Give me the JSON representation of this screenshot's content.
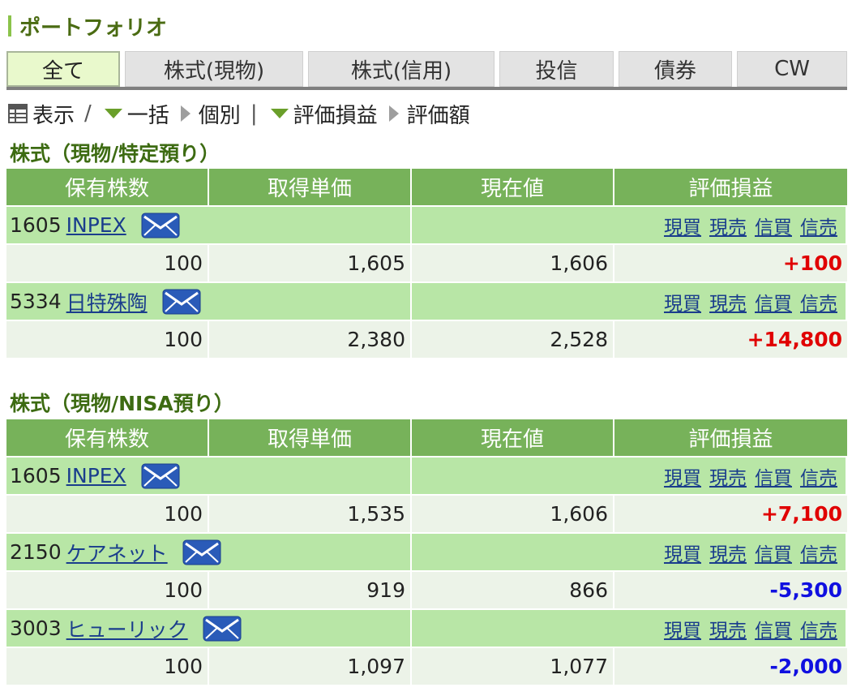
{
  "page": {
    "title": "ポートフォリオ"
  },
  "tabs": [
    {
      "label": "全て",
      "active": true
    },
    {
      "label": "株式(現物)"
    },
    {
      "label": "株式(信用)"
    },
    {
      "label": "投信"
    },
    {
      "label": "債券"
    },
    {
      "label": "CW"
    }
  ],
  "toolbar": {
    "display_label": "表示",
    "slash": "/",
    "bulk_label": "一括",
    "individual_label": "個別",
    "bar": "|",
    "eval_pl_label": "評価損益",
    "eval_amount_label": "評価額"
  },
  "headers": [
    "保有株数",
    "取得単価",
    "現在値",
    "評価損益"
  ],
  "actions": [
    "現買",
    "現売",
    "信買",
    "信売"
  ],
  "sections": [
    {
      "title": "株式（現物/特定預り）",
      "holdings": [
        {
          "code": "1605",
          "name": "INPEX",
          "shares": "100",
          "cost": "1,605",
          "price": "1,606",
          "pl": "+100",
          "sign": "pos"
        },
        {
          "code": "5334",
          "name": "日特殊陶",
          "shares": "100",
          "cost": "2,380",
          "price": "2,528",
          "pl": "+14,800",
          "sign": "pos"
        }
      ]
    },
    {
      "title": "株式（現物/NISA預り）",
      "holdings": [
        {
          "code": "1605",
          "name": "INPEX",
          "shares": "100",
          "cost": "1,535",
          "price": "1,606",
          "pl": "+7,100",
          "sign": "pos"
        },
        {
          "code": "2150",
          "name": "ケアネット",
          "shares": "100",
          "cost": "919",
          "price": "866",
          "pl": "-5,300",
          "sign": "neg"
        },
        {
          "code": "3003",
          "name": "ヒューリック",
          "shares": "100",
          "cost": "1,097",
          "price": "1,077",
          "pl": "-2,000",
          "sign": "neg"
        }
      ]
    }
  ],
  "colors": {
    "header_green": "#77b25a",
    "name_row": "#b8e6a6",
    "value_row": "#ecf3e8",
    "positive": "#e00000",
    "negative": "#1010e0",
    "link": "#1a3d8c"
  }
}
